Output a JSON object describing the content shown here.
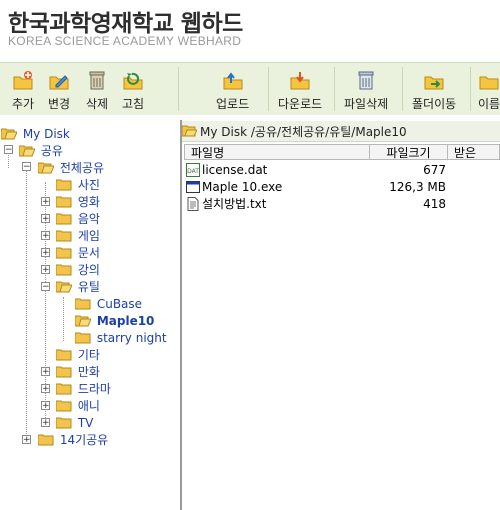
{
  "header": {
    "title_kr": "한국과학영재학교  웹하드",
    "title_en": "KOREA SCIENCE ACADEMY  WEBHARD"
  },
  "toolbar": {
    "left": [
      {
        "label": "추가",
        "icon": "add-folder-icon"
      },
      {
        "label": "변경",
        "icon": "edit-icon"
      },
      {
        "label": "삭제",
        "icon": "trash-icon"
      },
      {
        "label": "고침",
        "icon": "refresh-icon"
      }
    ],
    "right": [
      {
        "label": "업로드",
        "icon": "upload-icon"
      },
      {
        "label": "다운로드",
        "icon": "download-icon"
      },
      {
        "label": "파일삭제",
        "icon": "file-delete-icon"
      },
      {
        "label": "폴더이동",
        "icon": "folder-move-icon"
      },
      {
        "label": "이름"
      }
    ],
    "colors": {
      "bg": "#eaf2de"
    }
  },
  "tree": {
    "root": "My Disk",
    "public": "공유",
    "shared_all": "전체공유",
    "children": [
      "사진",
      "영화",
      "음악",
      "게임",
      "문서",
      "강의",
      "유틸",
      "기타",
      "만화",
      "드라마",
      "애니",
      "TV"
    ],
    "util_children": [
      "CuBase",
      "Maple10",
      "starry night"
    ],
    "group14": "14기공유",
    "selected": "Maple10"
  },
  "path": {
    "text": "My Disk /공유/전체공유/유틸/Maple10"
  },
  "files": {
    "columns": [
      "파일명",
      "파일크기",
      "받은"
    ],
    "rows": [
      {
        "name": "license.dat",
        "size": "677",
        "icon": "dat-file-icon"
      },
      {
        "name": "Maple 10.exe",
        "size": "126,3 MB",
        "icon": "exe-file-icon"
      },
      {
        "name": "설치방법.txt",
        "size": "418",
        "icon": "txt-file-icon"
      }
    ]
  }
}
